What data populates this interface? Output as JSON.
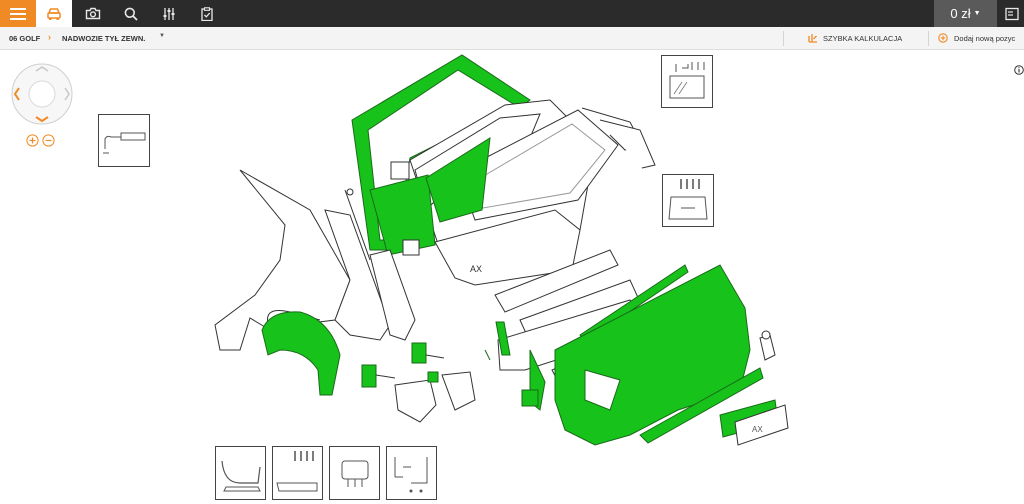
{
  "toolbar": {
    "icons": [
      "menu-icon",
      "car-icon",
      "camera-icon",
      "search-icon",
      "sliders-icon",
      "clipboard-icon",
      "exit-icon"
    ],
    "price": "0 zł"
  },
  "breadcrumb": {
    "model": "06 GOLF",
    "section": "NADWOZIE TYŁ ZEWN."
  },
  "actions": {
    "quick_calc": "SZYBKA KALKULACJA",
    "add_position": "Dodaj nową pozyc"
  },
  "diagram": {
    "plate_text": "AX",
    "plate_text_2": "AX",
    "highlight_color": "#17c21a"
  }
}
